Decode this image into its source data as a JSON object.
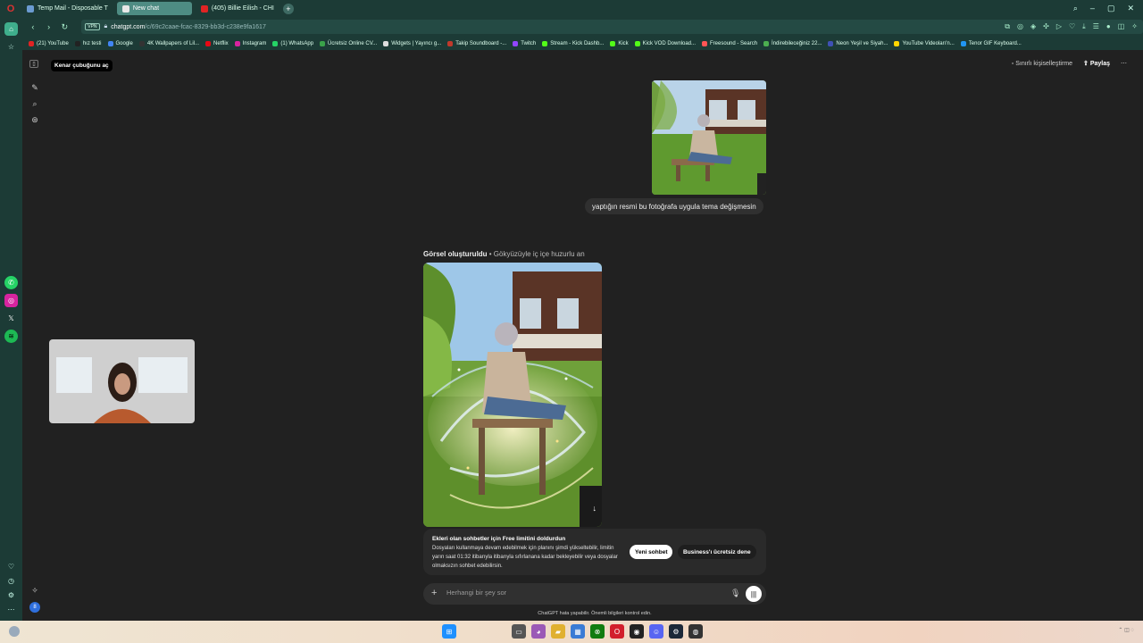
{
  "tabs": [
    {
      "label": "Temp Mail - Disposable T",
      "color": "#6b9bd1",
      "active": false
    },
    {
      "label": "New chat",
      "color": "#e8e8e8",
      "active": true
    },
    {
      "label": "(405) Billie Eilish - CHI",
      "color": "#e02424",
      "active": false
    }
  ],
  "address": {
    "vpn": "VPN",
    "url_host": "chatgpt.com",
    "url_path": "/c/69c2caae-fcac-8329-bb3d-c238e9fa1617"
  },
  "bookmarks": [
    {
      "label": "(21) YouTube",
      "color": "#e02424"
    },
    {
      "label": "hız testi",
      "color": "#222222"
    },
    {
      "label": "Google",
      "color": "#4285f4"
    },
    {
      "label": "4K Wallpapers of Lil...",
      "color": "#333333"
    },
    {
      "label": "Netflix",
      "color": "#e50914"
    },
    {
      "label": "Instagram",
      "color": "#d6249f"
    },
    {
      "label": "(1) WhatsApp",
      "color": "#25d366"
    },
    {
      "label": "Ücretsiz Online CV...",
      "color": "#3aa34a"
    },
    {
      "label": "Widgets | Yayıncı g...",
      "color": "#dddddd"
    },
    {
      "label": "Takip Soundboard -...",
      "color": "#c0392b"
    },
    {
      "label": "Twitch",
      "color": "#9146ff"
    },
    {
      "label": "Stream - Kick Dashb...",
      "color": "#53fc18"
    },
    {
      "label": "Kick",
      "color": "#53fc18"
    },
    {
      "label": "Kick VOD Download...",
      "color": "#53fc18"
    },
    {
      "label": "Freesound - Search",
      "color": "#ff5555"
    },
    {
      "label": "İndirebileceğiniz 22...",
      "color": "#4caf50"
    },
    {
      "label": "Neon Yeşil ve Siyah...",
      "color": "#3f51b5"
    },
    {
      "label": "YouTube Videoları'n...",
      "color": "#ffd600"
    },
    {
      "label": "Tenor GIF Keyboard...",
      "color": "#2196f3"
    }
  ],
  "gpt": {
    "tooltip": "Kenar çubuğunu aç",
    "personalize": "Sınırlı kişiselleştirme",
    "share": "Paylaş",
    "user_message": "yaptığın resmi bu fotoğrafa uygula tema değişmesin",
    "gen_caption_bold": "Görsel oluşturuldu",
    "gen_caption_rest": " • Gökyüzüyle iç içe huzurlu an",
    "limit_title": "Ekleri olan sohbetler için Free limitini doldurdun",
    "limit_body": "Dosyaları kullanmaya devam edebilmek için planını şimdi yükseltebilir, limitin yarın saat 01:32 itibarıyla itibarıyla sıfırlanana kadar bekleyebilir veya dosyalar olmaksızın sohbet edebilirsin.",
    "btn_new_chat": "Yeni sohbet",
    "btn_business": "Business'ı ücretsiz dene",
    "composer_placeholder": "Herhangi bir şey sor",
    "disclaimer": "ChatGPT hata yapabilir. Önemli bilgileri kontrol edin."
  },
  "opera_sidebar_icons": [
    "home-icon",
    "star-icon",
    "whatsapp-icon",
    "instagram-icon",
    "x-icon",
    "spotify-icon",
    "heart-icon",
    "history-icon",
    "settings-icon",
    "more-icon"
  ],
  "colors": {
    "browser_chrome": "#1c3b36",
    "page_bg": "#212121",
    "active_tab": "#4e8c83"
  }
}
